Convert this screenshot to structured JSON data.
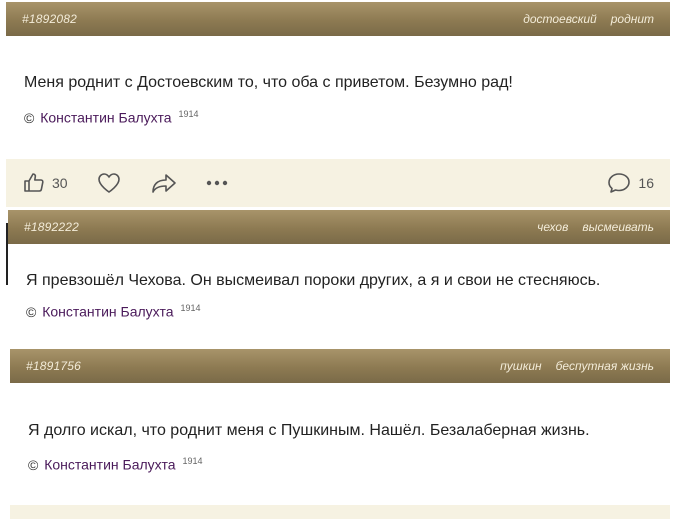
{
  "cards": [
    {
      "id": "#1892082",
      "tags": [
        "достоевский",
        "роднит"
      ],
      "text": "Меня роднит с Достоевским то, что оба с приветом. Безумно рад!",
      "author_copy": "©",
      "author": "Константин Балухта",
      "author_year": "1914",
      "likes": "30",
      "comments": "16"
    },
    {
      "id": "#1892222",
      "tags": [
        "чехов",
        "высмеивать"
      ],
      "text": "Я превзошёл Чехова. Он высмеивал пороки других, а я и свои не стесняюсь.",
      "author_copy": "©",
      "author": "Константин Балухта",
      "author_year": "1914"
    },
    {
      "id": "#1891756",
      "tags": [
        "пушкин",
        "беспутная жизнь"
      ],
      "text": "Я долго искал, что роднит меня с Пушкиным. Нашёл. Безалаберная жизнь.",
      "author_copy": "©",
      "author": "Константин Балухта",
      "author_year": "1914"
    }
  ],
  "icons": {
    "like": "thumbs-up-icon",
    "favorite": "heart-icon",
    "share": "share-icon",
    "more": "more-dots-icon",
    "comment": "comment-bubble-icon"
  },
  "colors": {
    "header": "#8d7a52",
    "header_text": "#f3ecd9",
    "footer_bg": "#f6f2e2",
    "author": "#4a1a5a"
  }
}
